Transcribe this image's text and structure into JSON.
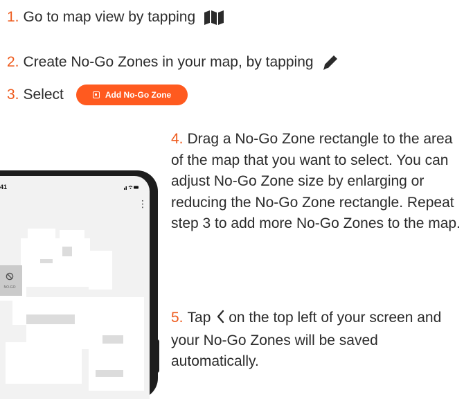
{
  "steps": [
    {
      "num": "1.",
      "text": "Go to map view by tapping",
      "icon": "map-icon"
    },
    {
      "num": "2.",
      "text": "Create No-Go Zones in your map, by tapping",
      "icon": "pencil-icon"
    },
    {
      "num": "3.",
      "text": "Select",
      "button_label": "Add No-Go Zone",
      "button_icon": "zone-square-icon"
    }
  ],
  "step4": {
    "num": "4.",
    "text": "Drag a No-Go Zone rectangle to the area of the map that you want to select. You can adjust No-Go Zone size by enlarging or reducing the No-Go Zone rectangle. Repeat step 3 to add more No-Go Zones to the map."
  },
  "step5": {
    "num": "5.",
    "text_before": "Tap",
    "icon": "chevron-left-icon",
    "text_after": "on the top left of your screen and your No-Go Zones will be saved automatically."
  },
  "phone": {
    "time": "41",
    "status_icons": "signal wifi battery",
    "menu_icon": "kebab-menu-icon",
    "zone_icon": "prohibited-icon",
    "zone_label": "NO-GO"
  },
  "colors": {
    "accent": "#EE5A1C",
    "button": "#FF5A1F",
    "text": "#2B2B2B",
    "phone_frame": "#1D1D1D",
    "map_floor": "#FFFFFF",
    "map_background": "#F2F2F2"
  }
}
